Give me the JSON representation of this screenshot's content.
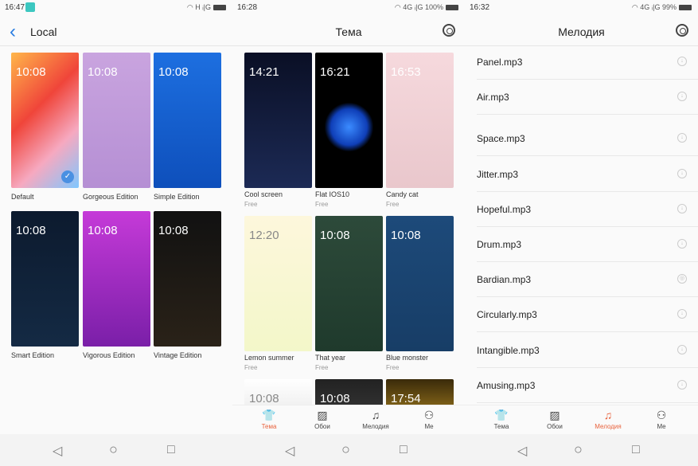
{
  "accent": "#e8623c",
  "panels": [
    {
      "time": "16:47",
      "signal": "H ᵢ|G",
      "title": "Local",
      "back": "‹",
      "items": [
        {
          "label": "Default",
          "clock": "10:08",
          "bg": "linear-gradient(135deg,#ffb64a,#f0453a 40%,#f6a9c0 70%,#7fc7ff)",
          "selected": true
        },
        {
          "label": "Gorgeous Edition",
          "clock": "10:08",
          "bg": "linear-gradient(180deg,#c9a4df,#b58fd4)"
        },
        {
          "label": "Simple Edition",
          "clock": "10:08",
          "bg": "linear-gradient(180deg,#1d6fe0,#0e4fbb)"
        },
        {
          "label": "Smart Edition",
          "clock": "10:08",
          "bg": "linear-gradient(180deg,#0c1a2e,#142a44)"
        },
        {
          "label": "Vigorous Edition",
          "clock": "10:08",
          "bg": "linear-gradient(180deg,#c53ad8,#7a1fa8)"
        },
        {
          "label": "Vintage Edition",
          "clock": "10:08",
          "bg": "linear-gradient(180deg,#111,#2a2218)"
        }
      ]
    },
    {
      "time": "16:28",
      "signal": "4G ᵢ|G 100%",
      "title": "Тема",
      "items": [
        {
          "label": "Cool screen",
          "price": "Free",
          "clock": "14:21",
          "bg": "linear-gradient(180deg,#0a0f25,#1c2a55)"
        },
        {
          "label": "Flat IOS10",
          "price": "Free",
          "clock": "16:21",
          "bg": "radial-gradient(circle at 50% 55%,#3b8bff 0,#0f3fb8 22%,#000 30%)"
        },
        {
          "label": "Candy cat",
          "price": "Free",
          "clock": "16:53",
          "bg": "linear-gradient(180deg,#f6d9dd,#e9c7cc)"
        },
        {
          "label": "Lemon summer",
          "price": "Free",
          "clock": "12:20",
          "bg": "linear-gradient(180deg,#fdf7dc,#f3f7c9)"
        },
        {
          "label": "That year",
          "price": "Free",
          "clock": "10:08",
          "bg": "linear-gradient(180deg,#2d4a3a,#1f3a2c)"
        },
        {
          "label": "Blue monster",
          "price": "Free",
          "clock": "10:08",
          "bg": "linear-gradient(180deg,#1d4a7a,#173d66)"
        },
        {
          "label": "",
          "price": "",
          "clock": "10:08",
          "bg": "linear-gradient(180deg,#fff,#eee)"
        },
        {
          "label": "",
          "price": "",
          "clock": "10:08",
          "bg": "linear-gradient(180deg,#222,#333)"
        },
        {
          "label": "",
          "price": "",
          "clock": "17:54",
          "bg": "linear-gradient(180deg,#3a2a0a,#8a6a1a)"
        }
      ]
    },
    {
      "time": "16:32",
      "signal": "4G ᵢ|G 99%",
      "title": "Мелодия",
      "songs": [
        "Panel.mp3",
        "Air.mp3",
        "Space.mp3",
        "Jitter.mp3",
        "Hopeful.mp3",
        "Drum.mp3",
        "Bardian.mp3",
        "Circularly.mp3",
        "Intangible.mp3",
        "Amusing.mp3"
      ]
    }
  ],
  "nav": [
    {
      "label": "Тема",
      "icon": "shirt-icon",
      "glyph": "👕"
    },
    {
      "label": "Обои",
      "icon": "image-icon",
      "glyph": "▨"
    },
    {
      "label": "Мелодия",
      "icon": "music-icon",
      "glyph": "♫"
    },
    {
      "label": "Me",
      "icon": "person-icon",
      "glyph": "⚇"
    }
  ],
  "sysnav": {
    "back": "◁",
    "home": "○",
    "recent": "□"
  }
}
